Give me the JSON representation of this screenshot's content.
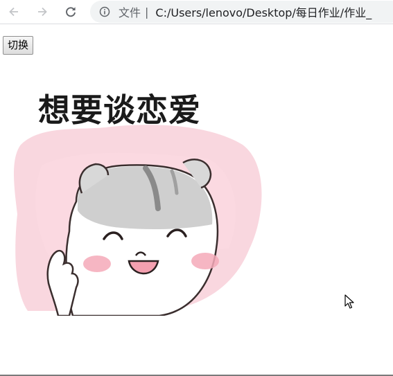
{
  "browser": {
    "security_label": "文件",
    "separator": "|",
    "url": "C:/Users/lenovo/Desktop/每日作业/作业_"
  },
  "page": {
    "switch_button_label": "切换",
    "meme": {
      "caption": "想要谈恋爱"
    }
  },
  "colors": {
    "omnibox_bg": "#f1f3f4",
    "icon_gray": "#5f6368",
    "pink_wash": "#f7c9d4",
    "hamster_gray": "#cfcfcf"
  }
}
